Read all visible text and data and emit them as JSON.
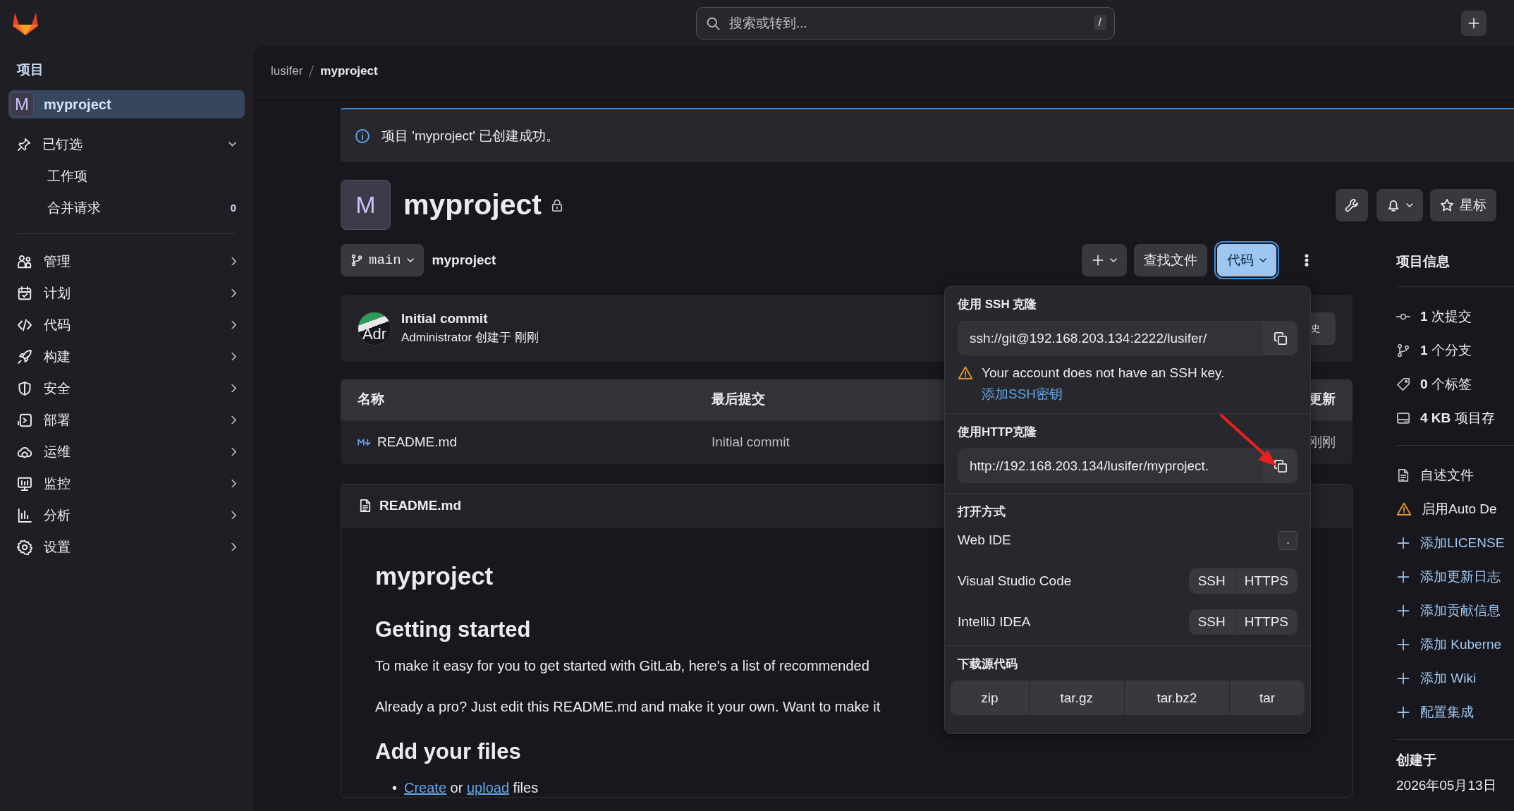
{
  "topbar": {
    "search": {
      "placeholder": "搜索或转到..."
    },
    "shortcut": "/"
  },
  "sidebar": {
    "heading": "项目",
    "project": {
      "avatar": "M",
      "name": "myproject",
      "selected": true
    },
    "pinned": {
      "label": "已钉选",
      "expanded": true,
      "children": [
        {
          "label": "工作项"
        },
        {
          "label": "合并请求",
          "count": "0"
        }
      ]
    },
    "items": [
      {
        "label": "管理"
      },
      {
        "label": "计划"
      },
      {
        "label": "代码"
      },
      {
        "label": "构建"
      },
      {
        "label": "安全"
      },
      {
        "label": "部署"
      },
      {
        "label": "运维"
      },
      {
        "label": "监控"
      },
      {
        "label": "分析"
      },
      {
        "label": "设置"
      }
    ]
  },
  "breadcrumb": [
    "lusifer",
    "myproject"
  ],
  "alert": {
    "text": "项目 'myproject' 已创建成功。"
  },
  "project": {
    "avatar": "M",
    "title": "myproject",
    "star_label": "星标"
  },
  "repo_bar": {
    "branch": "main",
    "path": "myproject",
    "find_file": "查找文件",
    "code_button": {
      "label": "代码",
      "expanded": true
    }
  },
  "commit": {
    "avatar_alt": "Adr",
    "title": "Initial commit",
    "author": "Administrator",
    "meta": "创建于 刚刚",
    "history_button": "史"
  },
  "table": {
    "columns": [
      "名称",
      "最后提交",
      "更新"
    ],
    "rows": [
      {
        "cells": [
          "README.md",
          "Initial commit",
          "刚刚"
        ]
      }
    ]
  },
  "readme": {
    "filename": "README.md",
    "blocks": [
      {
        "kind": "h1",
        "text": "myproject"
      },
      {
        "kind": "h2",
        "text": "Getting started"
      },
      {
        "kind": "p",
        "text": "To make it easy for you to get started with GitLab, here's a list of recommended"
      },
      {
        "kind": "p",
        "text": "Already a pro? Just edit this README.md and make it your own. Want to make it"
      },
      {
        "kind": "h2",
        "text": "Add your files"
      },
      {
        "kind": "li",
        "marker": "•",
        "segments": [
          {
            "kind": "link",
            "text": "Create"
          },
          {
            "kind": "text",
            "text": "or"
          },
          {
            "kind": "link",
            "text": "upload"
          },
          {
            "kind": "text",
            "text": "files"
          }
        ]
      }
    ]
  },
  "clone_menu": {
    "ssh": {
      "heading": "使用 SSH 克隆",
      "value": "ssh://git@192.168.203.134:2222/lusifer/"
    },
    "warning": "Your account does not have an SSH key.",
    "add_key_link": "添加SSH密钥",
    "http": {
      "heading": "使用HTTP克隆",
      "value": "http://192.168.203.134/lusifer/myproject."
    },
    "open_with": {
      "heading": "打开方式",
      "options": [
        {
          "kind": "key",
          "label": "Web IDE",
          "key": "."
        },
        {
          "kind": "pair",
          "label": "Visual Studio Code",
          "buttons": [
            "SSH",
            "HTTPS"
          ]
        },
        {
          "kind": "pair",
          "label": "IntelliJ IDEA",
          "buttons": [
            "SSH",
            "HTTPS"
          ]
        }
      ]
    },
    "download": {
      "heading": "下载源代码",
      "formats": [
        "zip",
        "tar.gz",
        "tar.bz2",
        "tar"
      ]
    }
  },
  "project_info": {
    "heading": "项目信息",
    "stats": [
      {
        "text": "**1** 次提交"
      },
      {
        "text": "**1** 个分支"
      },
      {
        "text": "**0** 个标签"
      },
      {
        "text": "**4 KB** 项目存"
      }
    ],
    "links": [
      {
        "kind": "file",
        "label": "自述文件"
      },
      {
        "kind": "warning",
        "label": "启用Auto De"
      },
      {
        "kind": "add",
        "label": "添加LICENSE"
      },
      {
        "kind": "add",
        "label": "添加更新日志"
      },
      {
        "kind": "add",
        "label": "添加贡献信息"
      },
      {
        "kind": "add",
        "label": "添加 Kuberne"
      },
      {
        "kind": "add",
        "label": "添加 Wiki"
      },
      {
        "kind": "add",
        "label": "配置集成"
      }
    ],
    "created": {
      "label": "创建于",
      "date": "2026年05月13日"
    }
  }
}
